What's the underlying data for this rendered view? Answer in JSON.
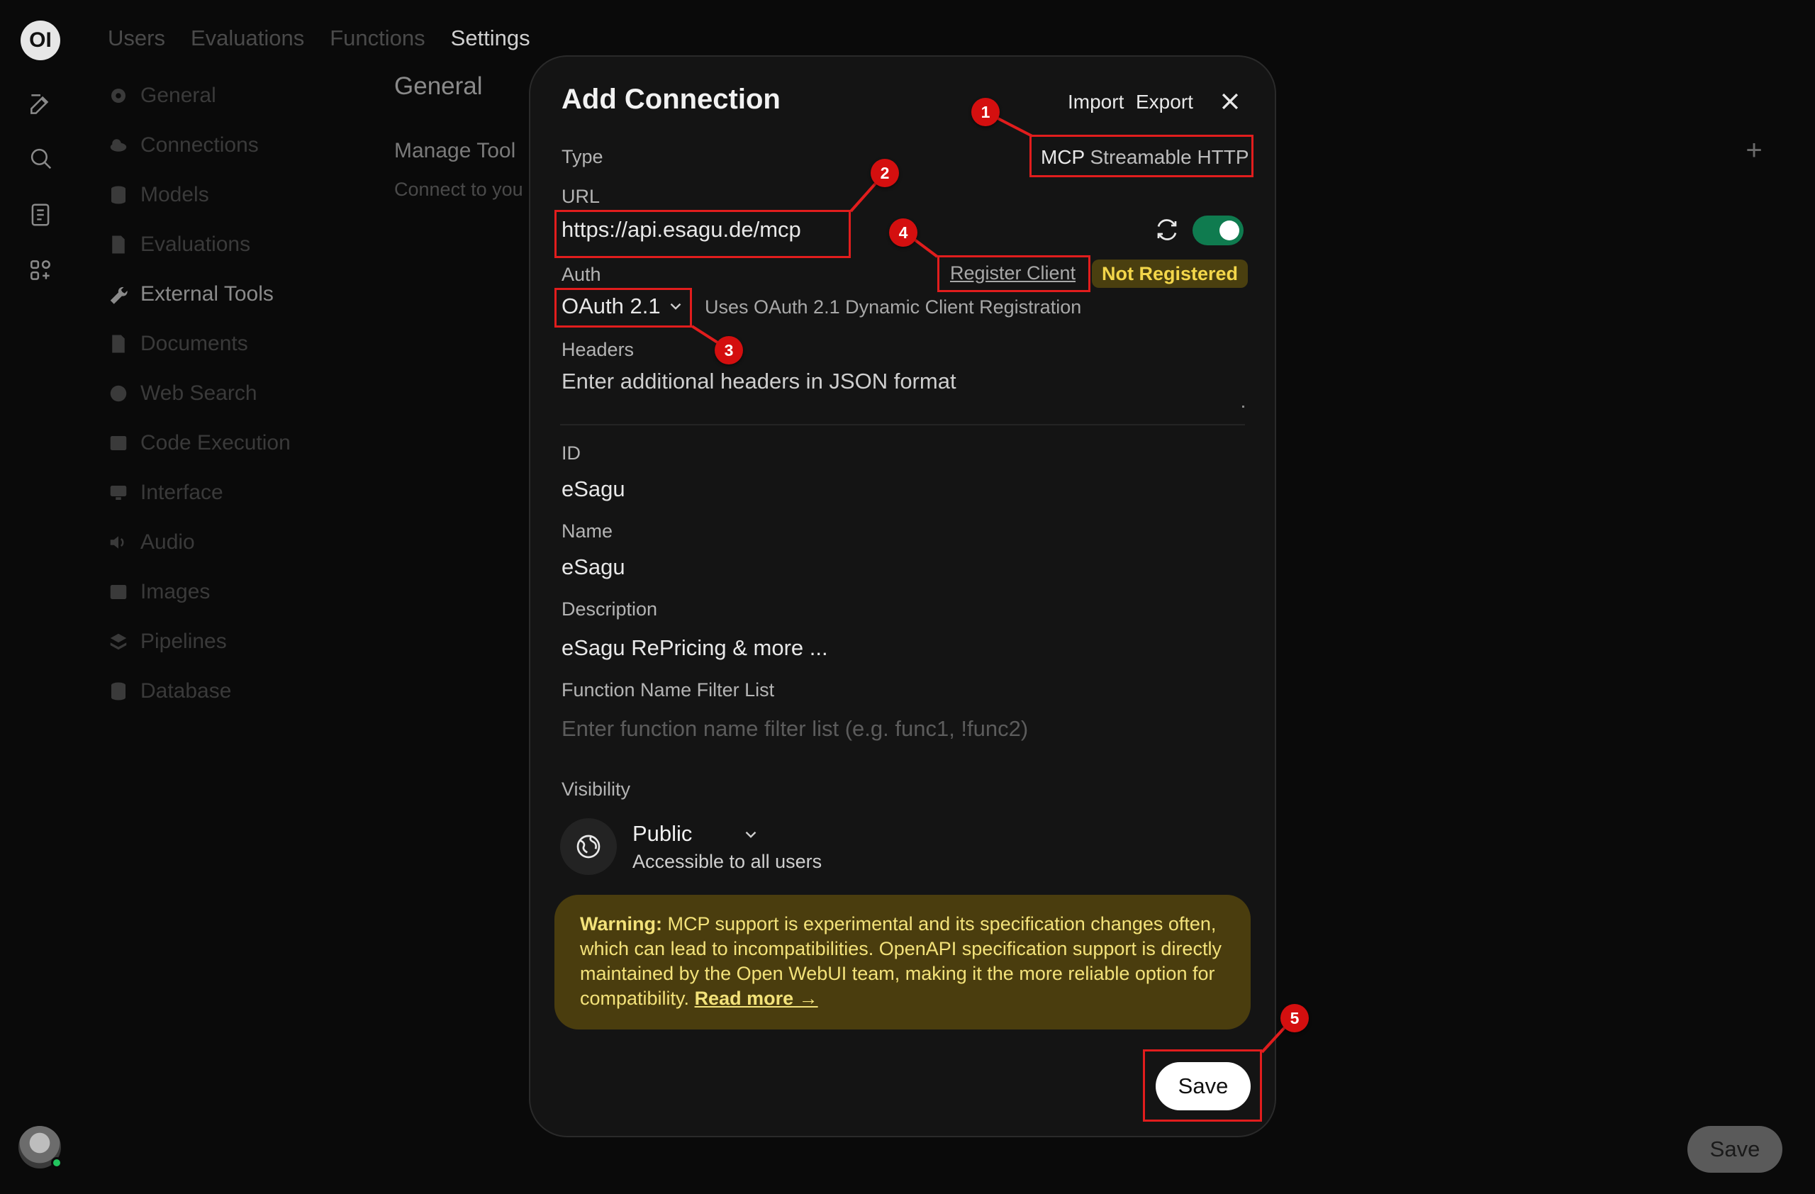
{
  "rail": {
    "logo_text": "OI",
    "icons": [
      "new-chat-icon",
      "search-icon",
      "notes-icon",
      "workspace-icon"
    ]
  },
  "top_tabs": [
    "Users",
    "Evaluations",
    "Functions",
    "Settings"
  ],
  "active_top_tab": "Settings",
  "settings_nav": [
    {
      "label": "General",
      "icon": "gear-icon"
    },
    {
      "label": "Connections",
      "icon": "cloud-icon"
    },
    {
      "label": "Models",
      "icon": "database-icon"
    },
    {
      "label": "Evaluations",
      "icon": "document-icon"
    },
    {
      "label": "External Tools",
      "icon": "wrench-icon"
    },
    {
      "label": "Documents",
      "icon": "document-icon"
    },
    {
      "label": "Web Search",
      "icon": "globe-icon"
    },
    {
      "label": "Code Execution",
      "icon": "terminal-icon"
    },
    {
      "label": "Interface",
      "icon": "monitor-icon"
    },
    {
      "label": "Audio",
      "icon": "speaker-icon"
    },
    {
      "label": "Images",
      "icon": "image-icon"
    },
    {
      "label": "Pipelines",
      "icon": "layers-icon"
    },
    {
      "label": "Database",
      "icon": "database-icon"
    }
  ],
  "active_nav": "External Tools",
  "content": {
    "title": "General",
    "section": "Manage Tool",
    "subtitle": "Connect to you"
  },
  "background_save": "Save",
  "modal": {
    "title": "Add Connection",
    "import": "Import",
    "export": "Export",
    "type_label": "Type",
    "type_value_prefix": "MCP",
    "type_value_rest": "Streamable HTTP",
    "url_label": "URL",
    "url_value": "https://api.esagu.de/mcp",
    "enabled": true,
    "register_client": "Register Client",
    "registration_status": "Not Registered",
    "auth_label": "Auth",
    "auth_value": "OAuth 2.1",
    "auth_hint": "Uses OAuth 2.1 Dynamic Client Registration",
    "headers_label": "Headers",
    "headers_placeholder": "Enter additional headers in JSON format",
    "id_label": "ID",
    "id_value": "eSagu",
    "name_label": "Name",
    "name_value": "eSagu",
    "description_label": "Description",
    "description_value": "eSagu RePricing & more ...",
    "filter_label": "Function Name Filter List",
    "filter_placeholder": "Enter function name filter list (e.g. func1, !func2)",
    "visibility_label": "Visibility",
    "visibility_value": "Public",
    "visibility_desc": "Accessible to all users",
    "warning_strong": "Warning:",
    "warning_text": " MCP support is experimental and its specification changes often, which can lead to incompatibilities. OpenAPI specification support is directly maintained by the Open WebUI team, making it the more reliable option for compatibility. ",
    "read_more": "Read more →",
    "save": "Save"
  },
  "annotations": {
    "color": "#e11d1d",
    "markers": [
      "1",
      "2",
      "3",
      "4",
      "5"
    ]
  }
}
